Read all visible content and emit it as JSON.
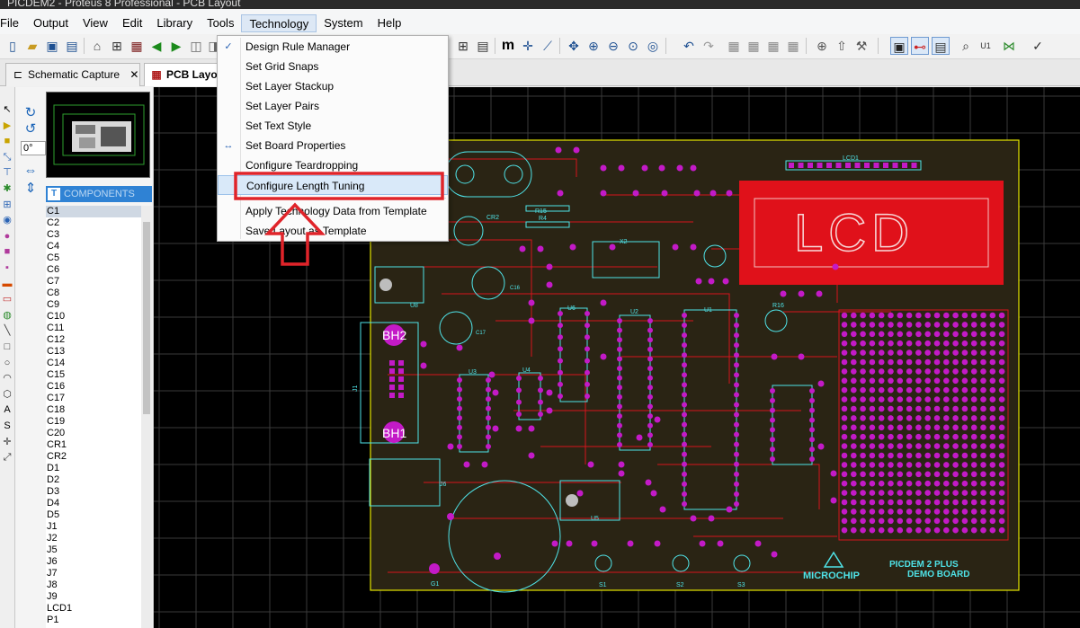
{
  "window": {
    "title": "PICDEM2 - Proteus 8 Professional - PCB Layout"
  },
  "menubar": {
    "items": [
      "File",
      "Output",
      "View",
      "Edit",
      "Library",
      "Tools",
      "Technology",
      "System",
      "Help"
    ],
    "active": "Technology"
  },
  "tabs": [
    {
      "label": "Schematic Capture",
      "close": "✕",
      "icon": "schematic-icon"
    },
    {
      "label": "PCB Layou",
      "icon": "pcb-icon"
    }
  ],
  "rotation": {
    "angle": "0°"
  },
  "components_panel": {
    "picker_letter": "T",
    "header": "COMPONENTS",
    "items": [
      "C1",
      "C2",
      "C3",
      "C4",
      "C5",
      "C6",
      "C7",
      "C8",
      "C9",
      "C10",
      "C11",
      "C12",
      "C13",
      "C14",
      "C15",
      "C16",
      "C17",
      "C18",
      "C19",
      "C20",
      "CR1",
      "CR2",
      "D1",
      "D2",
      "D3",
      "D4",
      "D5",
      "J1",
      "J2",
      "J5",
      "J6",
      "J7",
      "J8",
      "J9",
      "LCD1",
      "P1"
    ],
    "selected": "C1"
  },
  "technology_menu": {
    "items": [
      "Design Rule Manager",
      "Set Grid Snaps",
      "Set Layer Stackup",
      "Set Layer Pairs",
      "Set Text Style",
      "Set Board Properties",
      "Configure Teardropping",
      "Configure Length Tuning",
      "Apply Technology Data from Template",
      "Save Layout as Template"
    ],
    "highlighted": "Configure Length Tuning"
  },
  "annotation": {
    "highlight_color": "#e0242a"
  },
  "pcb": {
    "board_labels": {
      "lcd": "LCD",
      "demo_line1": "PICDEM 2 PLUS",
      "demo_line2": "DEMO BOARD",
      "brand": "MICROCHIP",
      "bh2": "BH2",
      "bh1": "BH1",
      "lcd1": "LCD1",
      "j1": "J1",
      "u1": "U1",
      "u2": "U2",
      "u3": "U3",
      "u4": "U4",
      "u5": "U5",
      "u6": "U6",
      "u8": "U8",
      "s1": "S1",
      "s2": "S2",
      "s3": "S3",
      "j6": "J6",
      "x2": "X2",
      "r4": "R4",
      "r15": "R15",
      "r16": "R16",
      "cr2": "CR2",
      "c16": "C16",
      "c17": "C17",
      "g1": "G1"
    },
    "colors": {
      "background": "#000000",
      "grid": "#3a3a3a",
      "board_outline": "#e6e600",
      "board_fill": "#2a2414",
      "copper_red": "#d7141d",
      "silk_cyan": "#4fe3e8",
      "pad_magenta": "#c31ac7",
      "lcd_block": "#e0111a"
    }
  }
}
